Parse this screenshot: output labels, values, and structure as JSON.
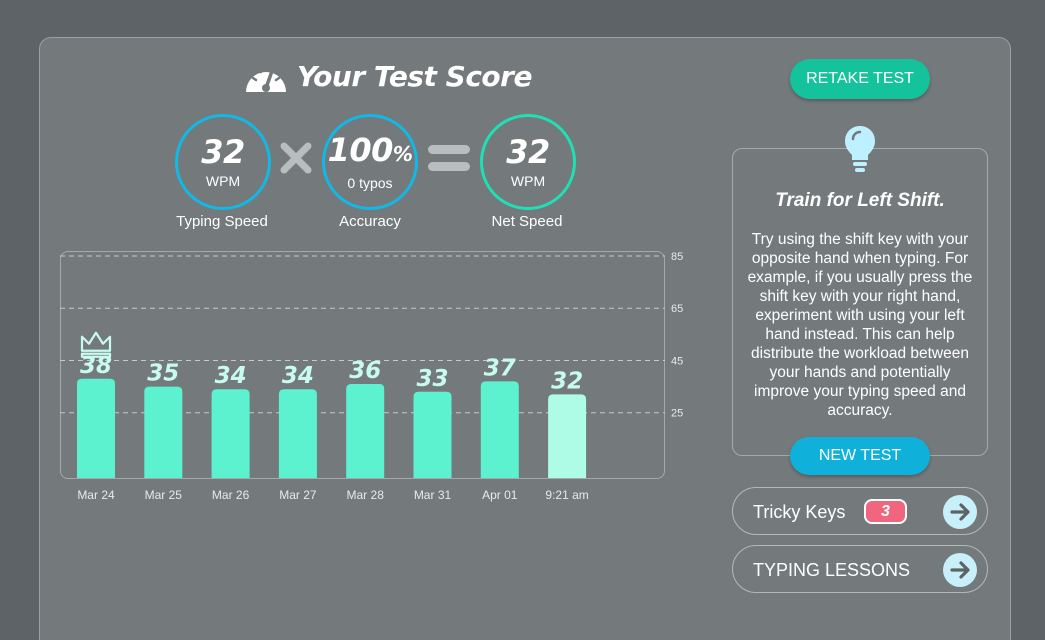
{
  "header": {
    "title": "Your Test Score",
    "title_icon": "speedometer-icon"
  },
  "scores": {
    "typing_speed": {
      "value": "32",
      "unit": "WPM",
      "label": "Typing Speed"
    },
    "accuracy": {
      "value": "100",
      "suffix": "%",
      "detail": "0 typos",
      "label": "Accuracy"
    },
    "net_speed": {
      "value": "32",
      "unit": "WPM",
      "label": "Net Speed"
    },
    "operator_times_icon": "times-icon",
    "operator_equals_icon": "equals-icon"
  },
  "chart_data": {
    "type": "bar",
    "categories": [
      "Mar 24",
      "Mar 25",
      "Mar 26",
      "Mar 27",
      "Mar 28",
      "Mar 31",
      "Apr 01",
      "9:21 am"
    ],
    "values": [
      38,
      35,
      34,
      34,
      36,
      33,
      37,
      32
    ],
    "ylim": [
      0,
      85
    ],
    "yticks": [
      25,
      45,
      65,
      85
    ],
    "grid": true,
    "best_index": 0,
    "best_icon": "crown-icon",
    "current_index": 7,
    "colors": {
      "bar": "#5cf2d0",
      "current": "#aefbe6",
      "label": "#c8fbef",
      "grid": "#c4cacc"
    }
  },
  "actions": {
    "retake": "RETAKE TEST",
    "new_test": "NEW TEST"
  },
  "tip": {
    "icon": "lightbulb-icon",
    "title": "Train for Left Shift.",
    "body": "Try using the shift key with your opposite hand when typing. For example, if you usually press the shift key with your right hand, experiment with using your left hand instead. This can help distribute the workload between your hands and potentially improve your typing speed and accuracy."
  },
  "links": {
    "tricky_keys": {
      "label": "Tricky Keys",
      "count": "3",
      "icon": "arrow-right-icon"
    },
    "typing_lessons": {
      "label": "TYPING LESSONS",
      "icon": "arrow-right-icon"
    }
  },
  "colors": {
    "background": "#5d6366",
    "panel": "#747a7c",
    "ring_blue": "#12b8e6",
    "ring_green": "#1fe0b4",
    "retake_button": "#14c39b",
    "new_test_button": "#0fb1da",
    "badge": "#f0667e"
  }
}
